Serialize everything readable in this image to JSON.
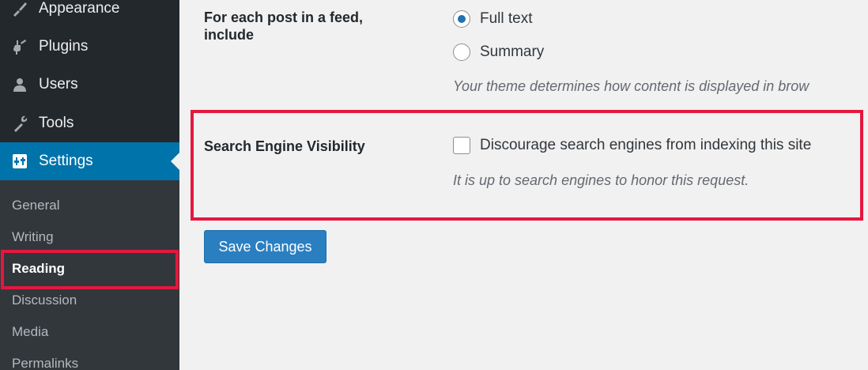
{
  "sidebar": {
    "menu": [
      {
        "label": "Appearance",
        "icon": "paintbrush-icon"
      },
      {
        "label": "Plugins",
        "icon": "plugin-icon"
      },
      {
        "label": "Users",
        "icon": "user-icon"
      },
      {
        "label": "Tools",
        "icon": "wrench-icon"
      },
      {
        "label": "Settings",
        "icon": "settings-icon",
        "active": true
      }
    ],
    "submenu": [
      {
        "label": "General"
      },
      {
        "label": "Writing"
      },
      {
        "label": "Reading",
        "current": true
      },
      {
        "label": "Discussion"
      },
      {
        "label": "Media"
      },
      {
        "label": "Permalinks"
      }
    ]
  },
  "feed": {
    "label": "For each post in a feed, include",
    "options": [
      "Full text",
      "Summary"
    ],
    "selected": "Full text",
    "description": "Your theme determines how content is displayed in brow"
  },
  "visibility": {
    "label": "Search Engine Visibility",
    "checkbox_label": "Discourage search engines from indexing this site",
    "checked": false,
    "description": "It is up to search engines to honor this request."
  },
  "save_button": "Save Changes",
  "colors": {
    "sidebar_bg": "#23282d",
    "submenu_bg": "#32373c",
    "active_bg": "#0073aa",
    "highlight": "#e5173f",
    "button": "#2a7fc1"
  }
}
